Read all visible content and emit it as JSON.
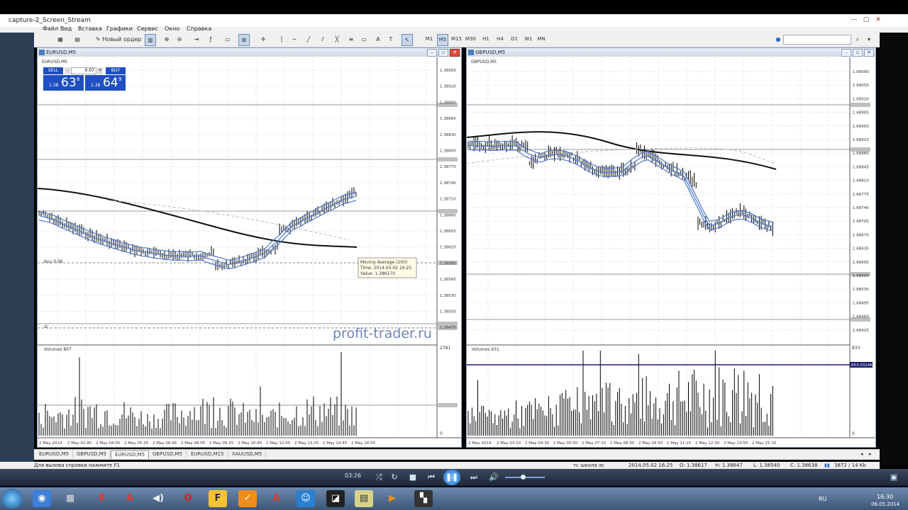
{
  "window": {
    "title": "capture-2_Screen_Stream",
    "controls": [
      "—",
      "▢",
      "✕"
    ]
  },
  "menu": [
    "Файл",
    "Вид",
    "Вставка",
    "Графики",
    "Сервис",
    "Окно",
    "Справка"
  ],
  "toolbar": {
    "new_order_label": "Новый ордер",
    "timeframes": [
      "M1",
      "M5",
      "M15",
      "M30",
      "H1",
      "H4",
      "D1",
      "W1",
      "MN"
    ],
    "active_timeframe": "M5"
  },
  "left_chart": {
    "window_title": "EURUSD,M5",
    "symbol_label": "EURUSD,M5",
    "trade_panel": {
      "sell_label": "SELL",
      "buy_label": "BUY",
      "lot_value": "0.07",
      "sell_price_prefix": "1.38",
      "sell_price_big": "63",
      "sell_price_sup": "8",
      "buy_price_prefix": "1.38",
      "buy_price_big": "64",
      "buy_price_sup": "9"
    },
    "price_scale": [
      "1.38950",
      "1.38920",
      "1.38890",
      "1.38860",
      "1.38830",
      "1.38800",
      "1.38770",
      "1.38740",
      "1.38710",
      "1.38680",
      "1.38650",
      "1.38620",
      "1.38590",
      "1.38560",
      "1.38530",
      "1.38500",
      "1.38470"
    ],
    "buy_line_label": "buy 0.06",
    "sl_line_label": "sl",
    "tooltip": {
      "line1": "Moving Average (200)",
      "line2": "Time: 2014.05.02 16:25",
      "line3": "Value: 1.386170"
    },
    "watermark": "profit-trader.ru",
    "volumes_label": "Volumes 807",
    "volume_scale_top": "2781",
    "volume_scale_bottom": "0",
    "time_axis": [
      "2 May 2014",
      "2 May 02:45",
      "2 May 04:05",
      "2 May 05:25",
      "2 May 06:45",
      "2 May 08:05",
      "2 May 09:25",
      "2 May 10:45",
      "2 May 12:05",
      "2 May 13:25",
      "2 May 14:45",
      "2 May 16:05"
    ]
  },
  "right_chart": {
    "window_title": "GBPUSD,M5",
    "symbol_label": "GBPUSD,M5",
    "price_scale": [
      "1.69090",
      "1.69055",
      "1.69020",
      "1.68985",
      "1.68950",
      "1.68915",
      "1.68880",
      "1.68845",
      "1.68810",
      "1.68775",
      "1.68740",
      "1.68705",
      "1.68670",
      "1.68635",
      "1.68600",
      "1.68565",
      "1.68530",
      "1.68495",
      "1.68460",
      "1.68425"
    ],
    "volumes_label": "Volumes 631",
    "volume_scale_top": "833",
    "volume_level_label": "653.03246",
    "volume_scale_bottom": "0",
    "time_axis": [
      "2 May 2014",
      "2 May 03:10",
      "2 May 04:30",
      "2 May 05:50",
      "2 May 07:10",
      "2 May 08:30",
      "2 May 09:50",
      "2 May 11:10",
      "2 May 12:30",
      "2 May 13:50",
      "2 May 15:10"
    ]
  },
  "chart_tabs": [
    "EURUSD,M5",
    "GBPUSD,M5",
    "EURUSD,M5",
    "GBPUSD,M5",
    "EURUSD,M15",
    "XAUUSD,M5"
  ],
  "active_chart_tab": 2,
  "status": {
    "help": "Для вызова справки нажмите F1",
    "profile": "тс школа ас",
    "datetime": "2014.05.02 16:25",
    "open": "O: 1.38617",
    "high": "H: 1.38647",
    "low": "L: 1.38540",
    "close": "C: 1.38638",
    "traffic": "3872 / 14 Kb"
  },
  "player": {
    "time": "03:26"
  },
  "taskbar": {
    "lang": "RU",
    "time": "16:30",
    "date": "06.05.2014"
  },
  "colors": {
    "ma200": "#111111",
    "ma_band": "#4a78c8",
    "buy_button": "#1f4fc0",
    "watermark": "#6f86b8"
  }
}
